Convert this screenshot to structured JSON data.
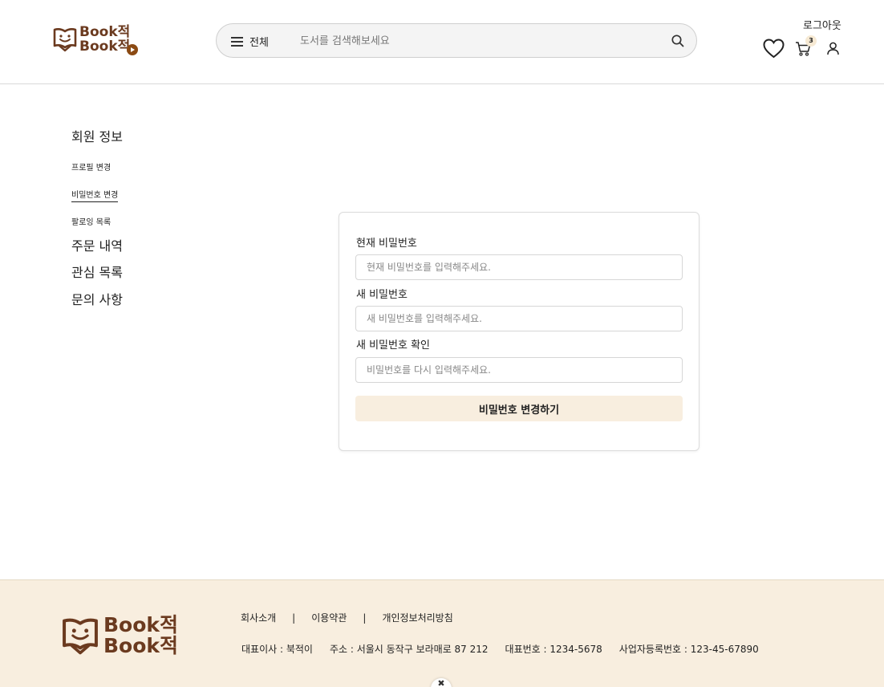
{
  "header": {
    "logo": {
      "line1": "Book적",
      "line2": "Book적"
    },
    "menu_label": "전체",
    "search_placeholder": "도서를 검색해보세요",
    "logout_label": "로그아웃",
    "cart_count": "3",
    "icons": {
      "menu": "hamburger-icon",
      "search": "search-icon",
      "wishlist": "heart-icon",
      "cart": "cart-icon",
      "profile": "user-icon"
    }
  },
  "sidebar": {
    "member_info": "회원 정보",
    "sub_items": [
      {
        "label": "프로필 변경"
      },
      {
        "label": "비밀번호 변경"
      },
      {
        "label": "팔로잉 목록"
      }
    ],
    "orders": "주문 내역",
    "wishlist": "관심 목록",
    "inquiries": "문의 사항"
  },
  "form": {
    "current_label": "현재 비밀번호",
    "current_placeholder": "현재 비밀번호를 입력해주세요.",
    "new_label": "새 비밀번호",
    "new_placeholder": "새 비밀번호를 입력해주세요.",
    "confirm_label": "새 비밀번호 확인",
    "confirm_placeholder": "비밀번호를 다시 입력해주세요.",
    "submit_label": "비밀번호 변경하기"
  },
  "footer": {
    "logo": {
      "line1": "Book적",
      "line2": "Book적"
    },
    "links": [
      "회사소개",
      "이용약관",
      "개인정보처리방침"
    ],
    "separator": "|",
    "ceo": "대표이사 : 북적이",
    "address": "주소 : 서울시 동작구 보라매로 87 212",
    "phone": "대표번호 : 1234-5678",
    "business_no": "사업자등록번호 : 123-45-67890",
    "close_glyph": "✖"
  },
  "colors": {
    "brand": "#6b3a1f",
    "accent_bg": "#f8eedf",
    "border": "#d9d9d9"
  }
}
